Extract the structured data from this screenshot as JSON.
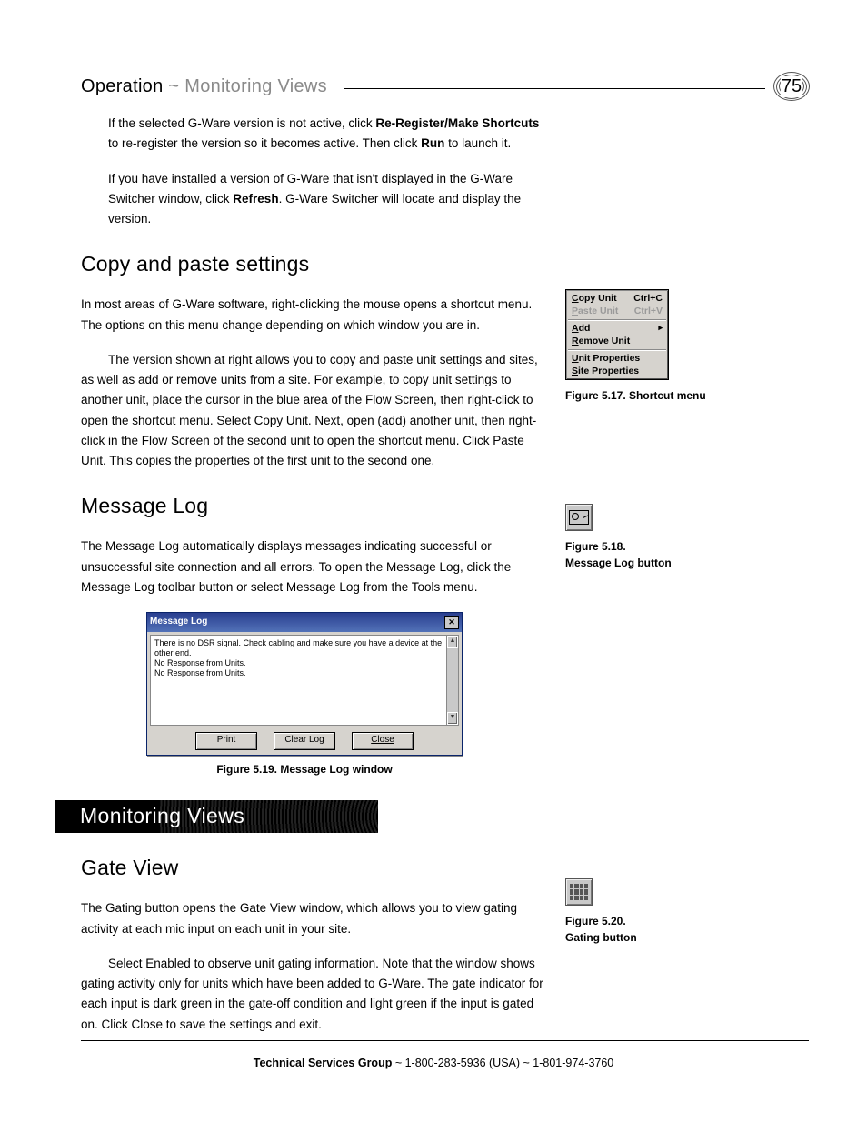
{
  "page_number": "75",
  "header": {
    "part1": "Operation",
    "sep": " ~ ",
    "part2": "Monitoring Views"
  },
  "para1_a": "If the selected G-Ware version is not active, click ",
  "para1_b": "Re-Register/Make Shortcuts",
  "para1_c": " to re-register the version so it becomes active. Then click ",
  "para1_d": "Run",
  "para1_e": " to launch it.",
  "para2_a": "If you have installed a version of G-Ware that isn't displayed in the G-Ware Switcher window, click ",
  "para2_b": "Refresh",
  "para2_c": ". G-Ware Switcher will locate and display the version.",
  "h_copy": "Copy and paste settings",
  "copy_p1": "In most areas of G-Ware software, right-clicking the mouse opens a shortcut menu. The options on this menu change depending on which window you are in.",
  "copy_p2": "The version shown at right allows you to copy and paste unit settings and sites, as well as add or remove units from a site. For example, to copy unit settings to another unit, place the cursor in the blue area of the Flow Screen, then right-click to open the shortcut menu. Select Copy Unit. Next, open (add) another unit, then right-click in the Flow Screen of the second unit to open the shortcut menu. Click Paste Unit. This copies the properties of the first unit to the second one.",
  "h_msglog": "Message Log",
  "msglog_p1": "The Message Log automatically displays messages indicating successful or unsuccessful site connection and all errors. To open the Message Log, click the Message Log toolbar button or select Message Log from the Tools menu.",
  "banner": "Monitoring Views",
  "h_gate": "Gate View",
  "gate_p1": "The Gating button opens the Gate View window, which allows you to view gating activity at each mic input on each unit in your site.",
  "gate_p2": "Select Enabled to observe unit gating information. Note that the window shows gating activity only for units which have been added to G-Ware. The gate indicator for each input is dark green in the gate-off condition and light green if the input is gated on. Click Close to save the settings and exit.",
  "ctxmenu": {
    "copy_unit": "Copy Unit",
    "copy_sc": "Ctrl+C",
    "paste_unit": "Paste Unit",
    "paste_sc": "Ctrl+V",
    "add": "Add",
    "remove": "Remove Unit",
    "unit_props": "Unit Properties",
    "site_props": "Site Properties"
  },
  "fig17": "Figure 5.17. Shortcut menu",
  "fig18a": "Figure 5.18.",
  "fig18b": "Message Log button",
  "fig19": "Figure 5.19. Message Log window",
  "fig20a": "Figure 5.20.",
  "fig20b": "Gating button",
  "msglog_window": {
    "title": "Message Log",
    "line1": "There is no DSR signal.  Check cabling and make sure you have a device at the other end.",
    "line2": "No Response from Units.",
    "line3": "No Response from Units.",
    "btn_print": "Print",
    "btn_clear": "Clear Log",
    "btn_close": "Close"
  },
  "footer_a": "Technical Services Group",
  "footer_b": " ~ 1-800-283-5936 (USA) ~ 1-801-974-3760"
}
